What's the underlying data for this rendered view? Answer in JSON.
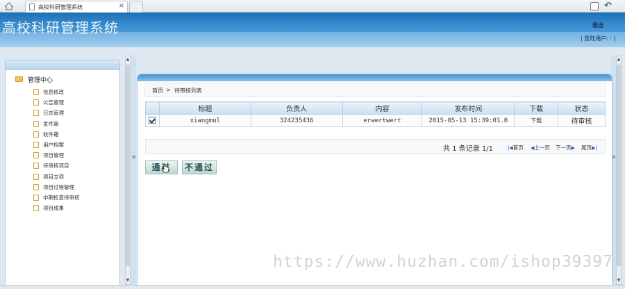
{
  "browser": {
    "tab_title": "高校科研管理系统",
    "tab_close": "×"
  },
  "header": {
    "title": "高校科研管理系统",
    "logout_label": "退出",
    "user_info": "| 登陆用户: :  |"
  },
  "sidebar": {
    "root_label": "管理中心",
    "items": [
      {
        "label": "信息修改"
      },
      {
        "label": "公告管理"
      },
      {
        "label": "日志管理"
      },
      {
        "label": "发件箱"
      },
      {
        "label": "收件箱"
      },
      {
        "label": "用户档案"
      },
      {
        "label": "项目管理"
      },
      {
        "label": "待审核项目"
      },
      {
        "label": "项目立项"
      },
      {
        "label": "项目过程管理"
      },
      {
        "label": "中期检查待审核"
      },
      {
        "label": "项目成果"
      }
    ]
  },
  "breadcrumb": {
    "home": "首页",
    "separator": ">",
    "current": "待审核列表"
  },
  "table": {
    "columns": [
      "标题",
      "负责人",
      "内容",
      "发布时间",
      "下载",
      "状态"
    ],
    "rows": [
      {
        "checked": true,
        "title": "xiangmul",
        "owner": "324235436",
        "content": "erwertwert",
        "time": "2015-05-13 15:39:01.0",
        "download": "下载",
        "status": "待审核"
      }
    ]
  },
  "pager": {
    "summary": "共 1 条记录 1/1",
    "first": "首页",
    "prev": "上一页",
    "next": "下一页",
    "last": "尾页"
  },
  "actions": {
    "approve": "通过",
    "reject": "不通过"
  },
  "watermark": "https://www.huzhan.com/ishop39397",
  "colors": {
    "header_blue": "#1b6fb5",
    "accent": "#2456a8"
  }
}
